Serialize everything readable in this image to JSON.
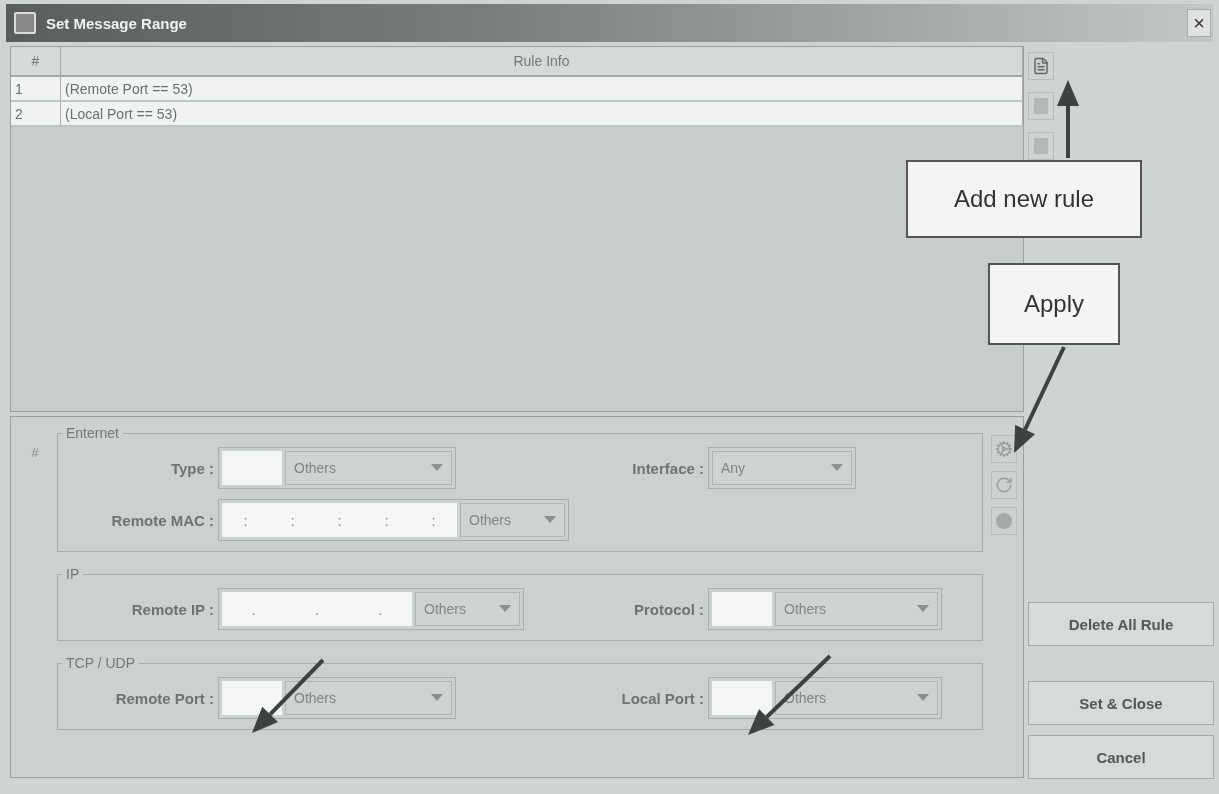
{
  "window": {
    "title": "Set Message Range",
    "close": "×"
  },
  "table": {
    "columns": [
      "#",
      "Rule Info"
    ],
    "rows": [
      {
        "cells": [
          "1",
          "(Remote Port == 53)"
        ]
      },
      {
        "cells": [
          "2",
          "(Local Port == 53)"
        ]
      }
    ]
  },
  "actions": [
    "Delete All Rule",
    "Set & Close",
    "Cancel"
  ],
  "editor": {
    "marker": "#",
    "groups": [
      {
        "title": "Enternet",
        "rows": [
          [
            {
              "label": "Type :",
              "kind": "combo",
              "option": "Others",
              "disabled": true
            },
            {
              "label": "Interface :",
              "kind": "select",
              "option": "Any",
              "disabled": true
            }
          ],
          [
            {
              "label": "Remote MAC :",
              "kind": "segmented",
              "separators": [
                ":",
                ":",
                ":",
                ":",
                ":"
              ],
              "option": "Others",
              "disabled": true
            }
          ]
        ]
      },
      {
        "title": "IP",
        "rows": [
          [
            {
              "label": "Remote IP :",
              "kind": "segmented",
              "separators": [
                ".",
                ".",
                "."
              ],
              "option": "Others",
              "disabled": true
            },
            {
              "label": "Protocol :",
              "kind": "combo",
              "option": "Others",
              "disabled": true
            }
          ]
        ]
      },
      {
        "title": "TCP / UDP",
        "rows": [
          [
            {
              "label": "Remote Port :",
              "kind": "combo",
              "option": "Others",
              "disabled": true
            },
            {
              "label": "Local Port :",
              "kind": "combo",
              "option": "Others",
              "disabled": true
            }
          ]
        ]
      }
    ]
  },
  "annotations": [
    {
      "text": "Add new rule"
    },
    {
      "text": "Apply"
    }
  ]
}
